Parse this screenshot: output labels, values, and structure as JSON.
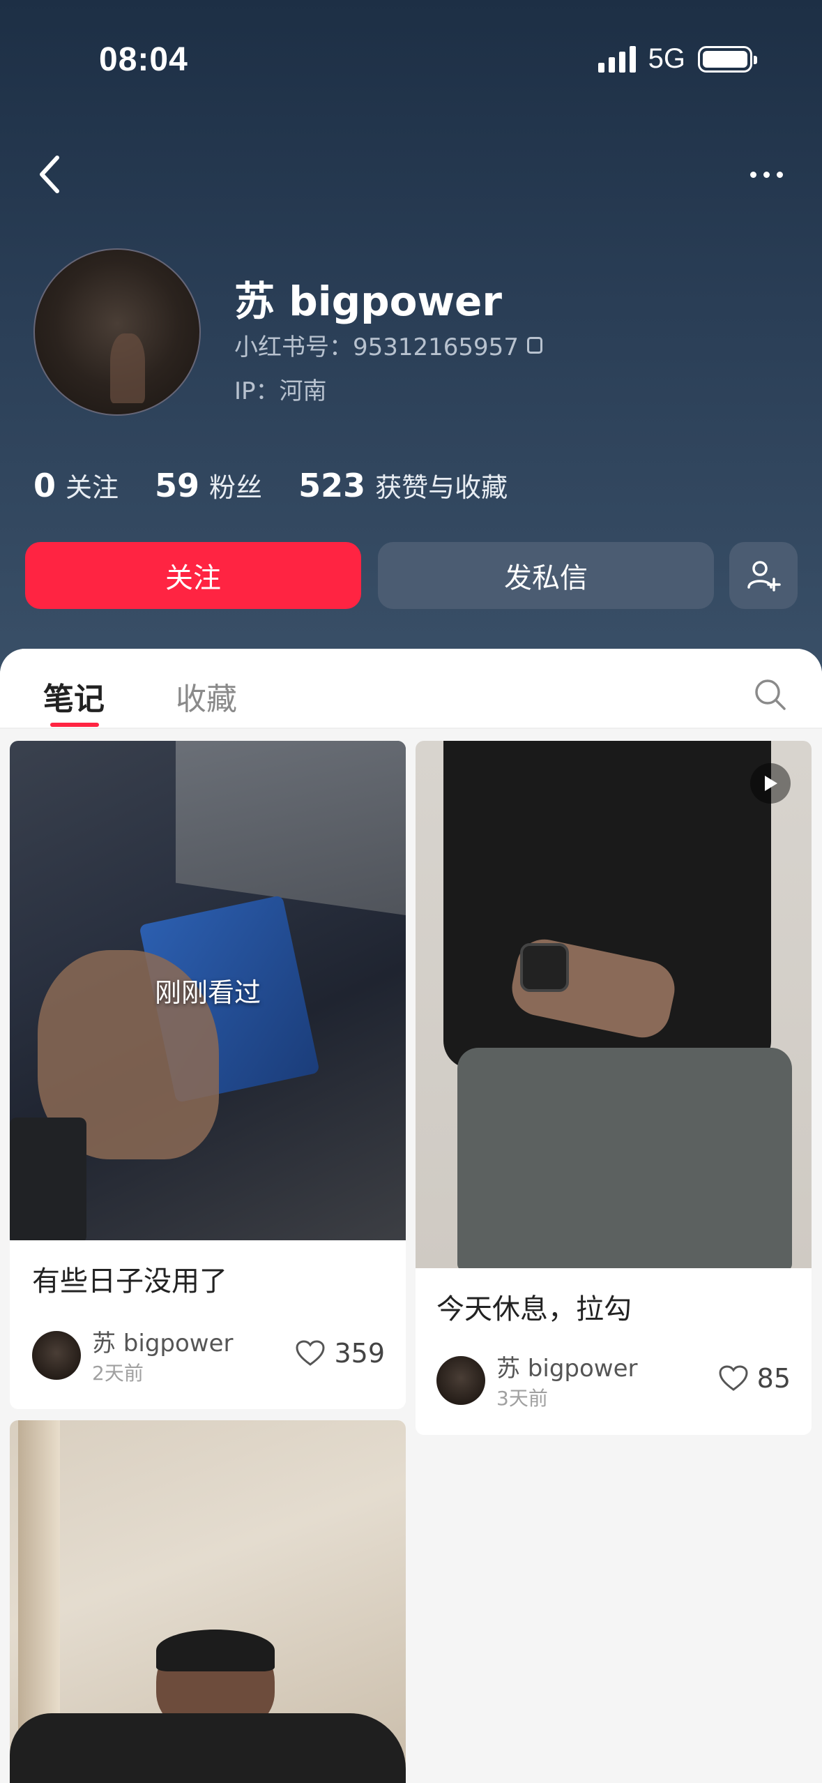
{
  "status_bar": {
    "time": "08:04",
    "network": "5G",
    "battery_level": 1.0
  },
  "profile": {
    "name": "苏 bigpower",
    "red_id": "小红书号：95312165957",
    "ip": "IP：河南"
  },
  "stats": [
    {
      "num": "0",
      "label": "关注"
    },
    {
      "num": "59",
      "label": "粉丝"
    },
    {
      "num": "523",
      "label": "获赞与收藏"
    }
  ],
  "actions": {
    "follow": "关注",
    "message": "发私信"
  },
  "tabs": [
    {
      "label": "笔记",
      "active": true
    },
    {
      "label": "收藏",
      "active": false
    }
  ],
  "notes": [
    {
      "title": "有些日子没用了",
      "author": "苏 bigpower",
      "time": "2天前",
      "likes": "359",
      "overlay": "刚刚看过",
      "video": false
    },
    {
      "title": "今天休息，拉勾",
      "author": "苏 bigpower",
      "time": "3天前",
      "likes": "85",
      "overlay": "",
      "video": true
    },
    {
      "title": "",
      "author": "",
      "time": "",
      "likes": "",
      "overlay": "",
      "video": false
    }
  ],
  "colors": {
    "accent": "#ff2442",
    "header_top": "#1d2f45",
    "header_bottom": "#3a5068"
  }
}
